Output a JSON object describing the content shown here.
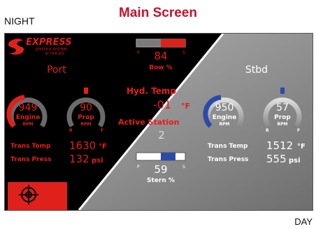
{
  "corner_left": "NIGHT",
  "corner_right": "DAY",
  "title": "Main Screen",
  "brand": {
    "name": "EXPRESS",
    "sub": "JOYSTICK SYSTEM",
    "by": "BY TWIN DISC"
  },
  "bow": {
    "value": "84",
    "label": "Bow %",
    "port_mark": "P",
    "stbd_mark": "S",
    "level": 0.5
  },
  "stern": {
    "value": "59",
    "label": "Stern %",
    "port_mark": "P",
    "stbd_mark": "S",
    "level": 0.3
  },
  "hyd": {
    "label": "Hyd. Temp",
    "value": "-01",
    "unit": "°F"
  },
  "station": {
    "label": "Active Station",
    "value": "2"
  },
  "port": {
    "label": "Port",
    "engine": {
      "value": "949",
      "label": "Engine",
      "unit": "RPM",
      "level": 0.45
    },
    "prop": {
      "value": "90",
      "label": "Prop",
      "unit": "RPM",
      "r_mark": "R",
      "f_mark": "F"
    },
    "trans_temp": {
      "label": "Trans Temp",
      "value": "1630",
      "unit": "°F"
    },
    "trans_press": {
      "label": "Trans Press",
      "value": "132",
      "unit": "psi"
    }
  },
  "stbd": {
    "label": "Stbd",
    "engine": {
      "value": "950",
      "label": "Engine",
      "unit": "RPM",
      "level": 0.45
    },
    "prop": {
      "value": "57",
      "label": "Prop",
      "unit": "RPM",
      "r_mark": "R",
      "f_mark": "F"
    },
    "trans_temp": {
      "label": "Trans Temp",
      "value": "1512",
      "unit": "°F"
    },
    "trans_press": {
      "label": "Trans Press",
      "value": "555",
      "unit": "psi"
    }
  },
  "colors": {
    "night_accent": "#e0201b",
    "day_accent": "#2b4aa8",
    "night_bg": "#000000",
    "day_bg": "#9a9a9a"
  },
  "icons": {
    "target": "crosshair-target-icon"
  }
}
